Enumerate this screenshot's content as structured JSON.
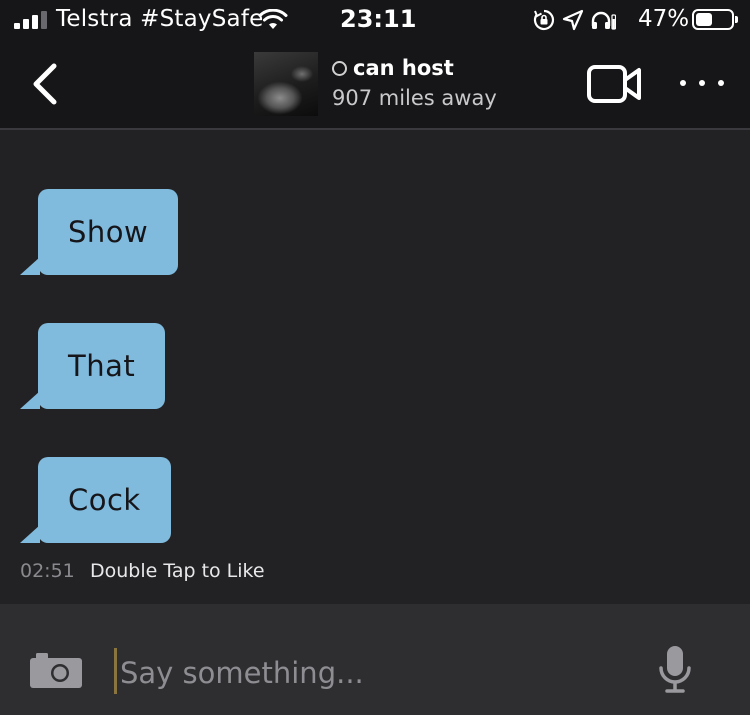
{
  "status_bar": {
    "carrier": "Telstra #StaySafe",
    "time": "23:11",
    "battery_percent": "47%",
    "battery_level": 0.47,
    "signal_bars_active": 3,
    "signal_bars_total": 4
  },
  "header": {
    "presence_text": "can host",
    "distance": "907 miles away",
    "icons": [
      "chevron-left-icon",
      "video-camera-icon",
      "more-icon"
    ]
  },
  "messages": [
    {
      "text": "Show"
    },
    {
      "text": "That"
    },
    {
      "text": "Cock"
    }
  ],
  "message_meta": {
    "time": "02:51",
    "like_hint": "Double Tap to Like"
  },
  "composer": {
    "placeholder": "Say something...",
    "value": "",
    "icons": [
      "camera-icon",
      "microphone-icon"
    ]
  },
  "colors": {
    "bubble": "#80bbde",
    "background": "#222225",
    "bar": "#161618",
    "composer": "#2e2e31"
  }
}
